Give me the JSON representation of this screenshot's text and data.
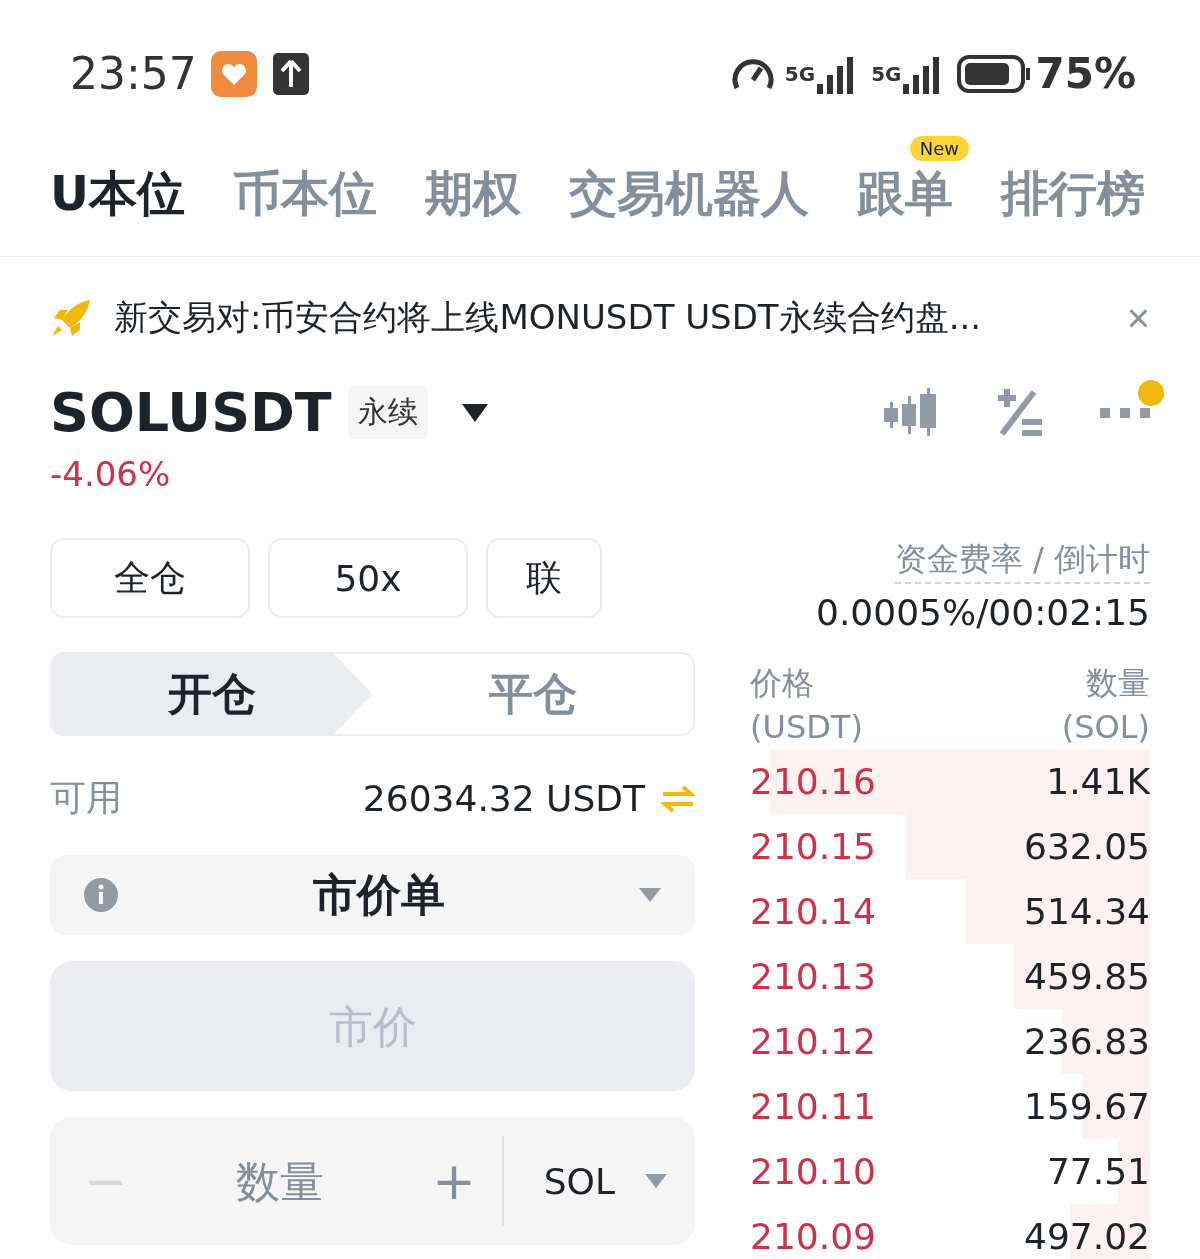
{
  "status_bar": {
    "time": "23:57",
    "networks": [
      "5G",
      "5G"
    ],
    "battery": "75%"
  },
  "tabs": [
    {
      "label": "U本位",
      "selected": true
    },
    {
      "label": "币本位",
      "selected": false
    },
    {
      "label": "期权",
      "selected": false
    },
    {
      "label": "交易机器人",
      "selected": false
    },
    {
      "label": "跟单",
      "selected": false,
      "badge": "New"
    },
    {
      "label": "排行榜",
      "selected": false
    }
  ],
  "announcement": {
    "text": "新交易对:币安合约将上线MONUSDT USDT永续合约盘...",
    "close": "×"
  },
  "symbol": {
    "name": "SOLUSDT",
    "tag": "永续",
    "change": "-4.06%",
    "has_notification": true
  },
  "margin_buttons": [
    "全仓",
    "50x",
    "联"
  ],
  "funding": {
    "label": "资金费率 / 倒计时",
    "value": "0.0005%/00:02:15"
  },
  "position_tabs": [
    {
      "label": "开仓",
      "selected": true
    },
    {
      "label": "平仓",
      "selected": false
    }
  ],
  "available": {
    "label": "可用",
    "value": "26034.32 USDT"
  },
  "order_type": {
    "value": "市价单"
  },
  "price_field": {
    "placeholder": "市价"
  },
  "quantity_field": {
    "minus": "−",
    "placeholder": "数量",
    "plus": "+",
    "unit": "SOL"
  },
  "order_book": {
    "price_header": "价格",
    "price_unit": "(USDT)",
    "qty_header": "数量",
    "qty_unit": "(SOL)",
    "rows": [
      {
        "price": "210.16",
        "qty": "1.41K"
      },
      {
        "price": "210.15",
        "qty": "632.05"
      },
      {
        "price": "210.14",
        "qty": "514.34"
      },
      {
        "price": "210.13",
        "qty": "459.85"
      },
      {
        "price": "210.12",
        "qty": "236.83"
      },
      {
        "price": "210.11",
        "qty": "159.67"
      },
      {
        "price": "210.10",
        "qty": "77.51"
      },
      {
        "price": "210.09",
        "qty": "497.02"
      }
    ]
  }
}
